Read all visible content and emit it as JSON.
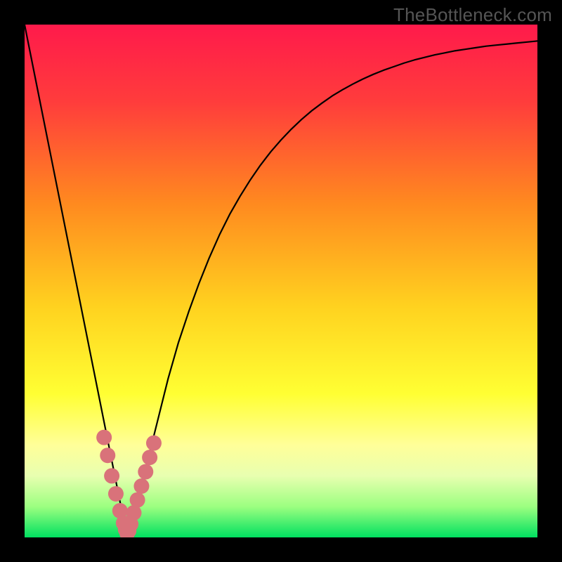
{
  "watermark": "TheBottleneck.com",
  "chart_data": {
    "type": "line",
    "title": "",
    "xlabel": "",
    "ylabel": "",
    "xlim": [
      0,
      100
    ],
    "ylim": [
      0,
      100
    ],
    "grid": false,
    "legend": false,
    "background_gradient": {
      "stops": [
        {
          "offset": 0.0,
          "color": "#ff1a4b"
        },
        {
          "offset": 0.15,
          "color": "#ff3c3c"
        },
        {
          "offset": 0.35,
          "color": "#ff8a1f"
        },
        {
          "offset": 0.55,
          "color": "#ffd21f"
        },
        {
          "offset": 0.72,
          "color": "#ffff33"
        },
        {
          "offset": 0.82,
          "color": "#ffff99"
        },
        {
          "offset": 0.88,
          "color": "#e8ffb0"
        },
        {
          "offset": 0.94,
          "color": "#9cff80"
        },
        {
          "offset": 1.0,
          "color": "#00e060"
        }
      ]
    },
    "series": [
      {
        "name": "bottleneck-curve",
        "stroke": "#000000",
        "stroke_width": 2.2,
        "x": [
          0,
          1,
          2,
          3,
          4,
          5,
          6,
          7,
          8,
          9,
          10,
          11,
          12,
          13,
          14,
          15,
          16,
          17,
          18,
          19,
          19.5,
          20,
          21,
          22,
          23,
          24,
          25,
          26,
          27,
          28,
          30,
          32,
          34,
          36,
          38,
          40,
          42,
          44,
          46,
          48,
          50,
          52,
          54,
          56,
          58,
          60,
          62,
          64,
          66,
          68,
          70,
          72,
          74,
          76,
          78,
          80,
          82,
          84,
          86,
          88,
          90,
          92,
          94,
          96,
          98,
          100
        ],
        "y": [
          100,
          95,
          90,
          85,
          80,
          75,
          70,
          65,
          60,
          55,
          50,
          45,
          40,
          35,
          30,
          25,
          20,
          15,
          10,
          5,
          2.5,
          0,
          3,
          7,
          11,
          15,
          19,
          23,
          27,
          31,
          38,
          44,
          49.5,
          54.5,
          59,
          63,
          66.5,
          69.7,
          72.6,
          75.2,
          77.5,
          79.6,
          81.5,
          83.2,
          84.7,
          86.1,
          87.3,
          88.4,
          89.4,
          90.3,
          91.1,
          91.8,
          92.5,
          93.1,
          93.6,
          94.1,
          94.5,
          94.9,
          95.2,
          95.5,
          95.8,
          96.0,
          96.2,
          96.4,
          96.6,
          96.8
        ]
      },
      {
        "name": "highlight-dots",
        "stroke": "#d9727a",
        "marker": "circle",
        "marker_size": 11,
        "x": [
          15.5,
          16.2,
          17.0,
          17.8,
          18.6,
          19.3,
          19.7,
          20.0,
          20.3,
          20.7,
          21.3,
          22.0,
          22.8,
          23.6,
          24.4,
          25.2
        ],
        "y": [
          19.5,
          16.0,
          12.0,
          8.5,
          5.2,
          2.8,
          1.5,
          0.8,
          1.3,
          2.6,
          4.8,
          7.3,
          10.0,
          12.8,
          15.6,
          18.4
        ]
      }
    ]
  }
}
